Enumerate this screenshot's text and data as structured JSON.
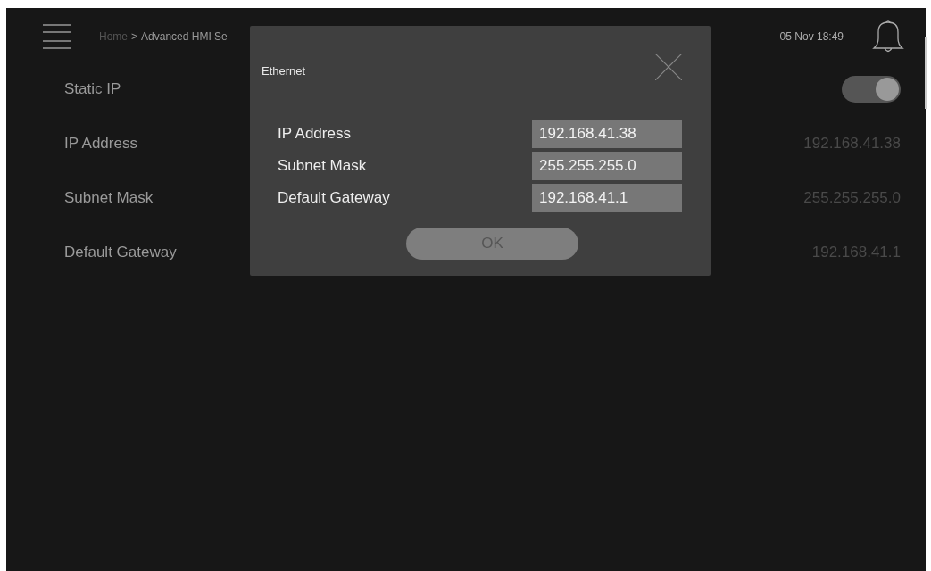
{
  "header": {
    "breadcrumb": {
      "parent": "Home",
      "separator": ">",
      "current": "Advanced HMI Se"
    },
    "datetime": "05 Nov 18:49"
  },
  "settings": [
    {
      "kind": "toggle",
      "label": "Static IP",
      "on": true
    },
    {
      "kind": "value",
      "label": "IP Address",
      "value": "192.168.41.38"
    },
    {
      "kind": "value",
      "label": "Subnet Mask",
      "value": "255.255.255.0"
    },
    {
      "kind": "value",
      "label": "Default Gateway",
      "value": "192.168.41.1"
    }
  ],
  "dialog": {
    "title": "Ethernet",
    "fields": [
      {
        "label": "IP Address",
        "value": "192.168.41.38"
      },
      {
        "label": "Subnet Mask",
        "value": "255.255.255.0"
      },
      {
        "label": "Default Gateway",
        "value": "192.168.41.1"
      }
    ],
    "ok_button": "OK"
  }
}
